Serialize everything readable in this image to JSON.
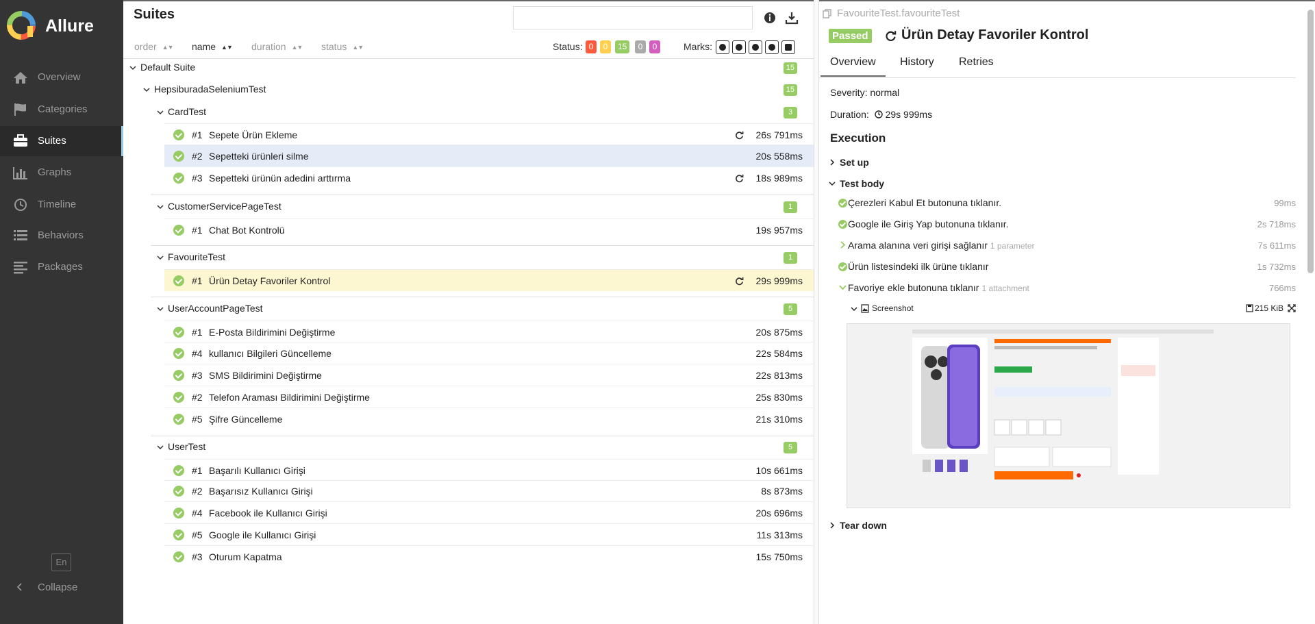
{
  "app": {
    "name": "Allure"
  },
  "sidebar": {
    "items": [
      {
        "label": "Overview",
        "icon": "home-icon"
      },
      {
        "label": "Categories",
        "icon": "flag-icon"
      },
      {
        "label": "Suites",
        "icon": "briefcase-icon"
      },
      {
        "label": "Graphs",
        "icon": "bar-chart-icon"
      },
      {
        "label": "Timeline",
        "icon": "clock-icon"
      },
      {
        "label": "Behaviors",
        "icon": "list-icon"
      },
      {
        "label": "Packages",
        "icon": "align-left-icon"
      }
    ],
    "active": "Suites",
    "lang": "En",
    "collapse": "Collapse"
  },
  "suites": {
    "title": "Suites",
    "search_value": "",
    "sort": {
      "order": "order",
      "name": "name",
      "duration": "duration",
      "status": "status"
    },
    "status_label": "Status:",
    "status_counts": {
      "failed": "0",
      "broken": "0",
      "passed": "15",
      "skipped": "0",
      "unknown": "0"
    },
    "marks_label": "Marks:",
    "tree": {
      "root": {
        "name": "Default Suite",
        "count": "15"
      },
      "package": {
        "name": "HepsiburadaSeleniumTest",
        "count": "15"
      },
      "groups": [
        {
          "name": "CardTest",
          "count": "3",
          "tests": [
            {
              "num": "#1",
              "name": "Sepete Ürün Ekleme",
              "duration": "26s 791ms",
              "retried": true
            },
            {
              "num": "#2",
              "name": "Sepetteki ürünleri silme",
              "duration": "20s 558ms",
              "retried": false
            },
            {
              "num": "#3",
              "name": "Sepetteki ürünün adedini arttırma",
              "duration": "18s 989ms",
              "retried": true
            }
          ]
        },
        {
          "name": "CustomerServicePageTest",
          "count": "1",
          "tests": [
            {
              "num": "#1",
              "name": "Chat Bot Kontrolü",
              "duration": "19s 957ms",
              "retried": false
            }
          ]
        },
        {
          "name": "FavouriteTest",
          "count": "1",
          "tests": [
            {
              "num": "#1",
              "name": "Ürün Detay Favoriler Kontrol",
              "duration": "29s 999ms",
              "retried": true
            }
          ]
        },
        {
          "name": "UserAccountPageTest",
          "count": "5",
          "tests": [
            {
              "num": "#1",
              "name": "E-Posta Bildirimini Değiştirme",
              "duration": "20s 875ms",
              "retried": false
            },
            {
              "num": "#4",
              "name": "kullanıcı Bilgileri Güncelleme",
              "duration": "22s 584ms",
              "retried": false
            },
            {
              "num": "#3",
              "name": "SMS Bildirimini Değiştirme",
              "duration": "22s 813ms",
              "retried": false
            },
            {
              "num": "#2",
              "name": "Telefon Araması Bildirimini Değiştirme",
              "duration": "25s 830ms",
              "retried": false
            },
            {
              "num": "#5",
              "name": "Şifre Güncelleme",
              "duration": "21s 310ms",
              "retried": false
            }
          ]
        },
        {
          "name": "UserTest",
          "count": "5",
          "tests": [
            {
              "num": "#1",
              "name": "Başarılı Kullanıcı Girişi",
              "duration": "10s 661ms",
              "retried": false
            },
            {
              "num": "#2",
              "name": "Başarısız Kullanıcı Girişi",
              "duration": "8s 873ms",
              "retried": false
            },
            {
              "num": "#4",
              "name": "Facebook ile Kullanıcı Girişi",
              "duration": "20s 696ms",
              "retried": false
            },
            {
              "num": "#5",
              "name": "Google ile Kullanıcı Girişi",
              "duration": "11s 313ms",
              "retried": false
            },
            {
              "num": "#3",
              "name": "Oturum Kapatma",
              "duration": "15s 750ms",
              "retried": false
            }
          ]
        }
      ]
    }
  },
  "detail": {
    "full_name": "FavouriteTest.favouriteTest",
    "status": "Passed",
    "title": "Ürün Detay Favoriler Kontrol",
    "tabs": [
      "Overview",
      "History",
      "Retries"
    ],
    "severity": "Severity: normal",
    "duration_label": "Duration:",
    "duration": "29s 999ms",
    "execution": "Execution",
    "setup": "Set up",
    "test_body": "Test body",
    "steps": [
      {
        "name": "Çerezleri Kabul Et butonuna tıklanır.",
        "extra": "",
        "duration": "99ms",
        "kind": "ok"
      },
      {
        "name": "Google ile Giriş Yap butonuna tıklanır.",
        "extra": "",
        "duration": "2s 718ms",
        "kind": "ok"
      },
      {
        "name": "Arama alanına veri girişi sağlanır",
        "extra": "1 parameter",
        "duration": "7s 611ms",
        "kind": "collapsed"
      },
      {
        "name": "Ürün listesindeki ilk ürüne tıklanır",
        "extra": "",
        "duration": "1s 732ms",
        "kind": "ok"
      },
      {
        "name": "Favoriye ekle butonuna tıklanır",
        "extra": "1 attachment",
        "duration": "766ms",
        "kind": "expanded"
      }
    ],
    "attachment": {
      "name": "Screenshot",
      "size": "215 KiB"
    },
    "teardown": "Tear down",
    "colors": {
      "passed": "#97cc64",
      "failed": "#fd5a3e",
      "broken": "#ffd050",
      "skipped": "#aaaaaa",
      "unknown": "#d35ebe"
    }
  }
}
